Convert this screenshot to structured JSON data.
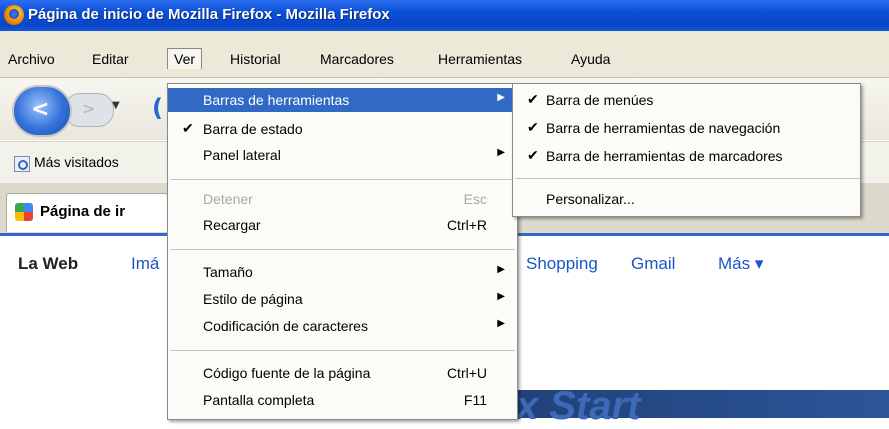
{
  "window": {
    "title": "Página de inicio de Mozilla Firefox - Mozilla Firefox"
  },
  "menubar": {
    "items": [
      {
        "label": "Archivo"
      },
      {
        "label": "Editar"
      },
      {
        "label": "Ver"
      },
      {
        "label": "Historial"
      },
      {
        "label": "Marcadores"
      },
      {
        "label": "Herramientas"
      },
      {
        "label": "Ayuda"
      }
    ]
  },
  "toolbar": {
    "back_glyph": "<",
    "forward_glyph": ">",
    "dropdown_glyph": "▼"
  },
  "bookmarks": {
    "item": "Más visitados"
  },
  "tab": {
    "label": "Página de ir"
  },
  "page": {
    "nav": [
      "La Web",
      "Imá",
      "Shopping",
      "Gmail",
      "Más ▾"
    ],
    "banner_text": "x Start"
  },
  "ver_menu": {
    "items": [
      {
        "label": "Barras de herramientas",
        "shortcut": "",
        "checked": false,
        "disabled": false,
        "submenu": true,
        "highlighted": true
      },
      {
        "label": "Barra de estado",
        "shortcut": "",
        "checked": true,
        "disabled": false,
        "submenu": false
      },
      {
        "label": "Panel lateral",
        "shortcut": "",
        "checked": false,
        "disabled": false,
        "submenu": true
      },
      {
        "label": "Detener",
        "shortcut": "Esc",
        "checked": false,
        "disabled": true,
        "submenu": false
      },
      {
        "label": "Recargar",
        "shortcut": "Ctrl+R",
        "checked": false,
        "disabled": false,
        "submenu": false
      },
      {
        "label": "Tamaño",
        "shortcut": "",
        "checked": false,
        "disabled": false,
        "submenu": true
      },
      {
        "label": "Estilo de página",
        "shortcut": "",
        "checked": false,
        "disabled": false,
        "submenu": true
      },
      {
        "label": "Codificación de caracteres",
        "shortcut": "",
        "checked": false,
        "disabled": false,
        "submenu": true
      },
      {
        "label": "Código fuente de la página",
        "shortcut": "Ctrl+U",
        "checked": false,
        "disabled": false,
        "submenu": false
      },
      {
        "label": "Pantalla completa",
        "shortcut": "F11",
        "checked": false,
        "disabled": false,
        "submenu": false
      }
    ]
  },
  "toolbars_submenu": {
    "items": [
      {
        "label": "Barra de menúes",
        "checked": true
      },
      {
        "label": "Barra de herramientas de navegación",
        "checked": true
      },
      {
        "label": "Barra de herramientas de marcadores",
        "checked": true
      },
      {
        "label": "Personalizar...",
        "checked": false
      }
    ]
  },
  "glyphs": {
    "check": "✔",
    "submenu_arrow": "▶"
  },
  "colors": {
    "highlight": "#316ac5",
    "titlebar": "#0b4fd6",
    "menu_bg": "#fbfbf8"
  }
}
